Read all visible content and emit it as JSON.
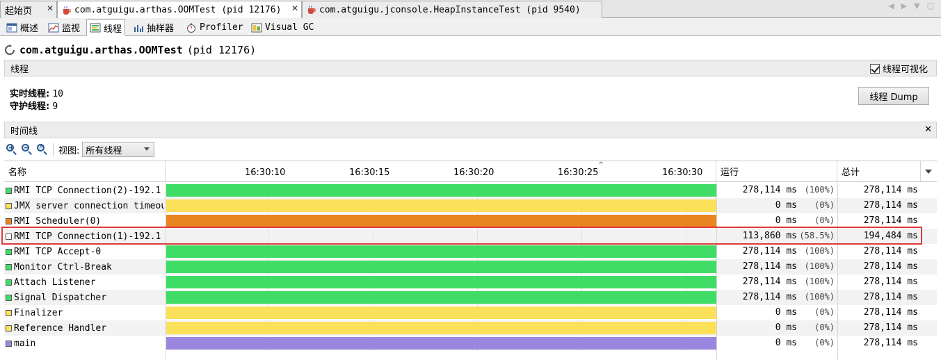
{
  "doc_tabs": [
    {
      "label": "起始页"
    },
    {
      "label": "com.atguigu.arthas.OOMTest (pid 12176)"
    },
    {
      "label": "com.atguigu.jconsole.HeapInstanceTest (pid 9540)"
    }
  ],
  "sub_tabs": [
    {
      "label": "概述"
    },
    {
      "label": "监视"
    },
    {
      "label": "线程"
    },
    {
      "label": "抽样器"
    },
    {
      "label": "Profiler"
    },
    {
      "label": "Visual GC"
    }
  ],
  "header": {
    "app_name": "com.atguigu.arthas.OOMTest",
    "pid": "(pid 12176)"
  },
  "threads_section": {
    "title": "线程",
    "visualize_label": "线程可视化",
    "visualize_checked": true,
    "live_label": "实时线程:",
    "live_value": "10",
    "daemon_label": "守护线程:",
    "daemon_value": "9",
    "dump_button": "线程 Dump"
  },
  "timeline_section": {
    "title": "时间线",
    "view_label": "视图:",
    "view_selected": "所有线程"
  },
  "table": {
    "columns": {
      "name": "名称",
      "running": "运行",
      "total": "总计"
    },
    "ticks": [
      "16:30:10",
      "16:30:15",
      "16:30:20",
      "16:30:25",
      "16:30:30"
    ],
    "rows": [
      {
        "name": "RMI TCP Connection(2)-192.1",
        "state_color": "#3fdd66",
        "running": "278,114 ms",
        "pct": "(100%)",
        "total": "278,114 ms"
      },
      {
        "name": "JMX server connection timeout",
        "state_color": "#fbe05a",
        "running": "0 ms",
        "pct": "(0%)",
        "total": "278,114 ms"
      },
      {
        "name": "RMI Scheduler(0)",
        "state_color": "#ea8421",
        "running": "0 ms",
        "pct": "(0%)",
        "total": "278,114 ms"
      },
      {
        "name": "RMI TCP Connection(1)-192.1",
        "state_color": "#ffffff",
        "running": "113,860 ms",
        "pct": "(58.5%)",
        "total": "194,484 ms"
      },
      {
        "name": "RMI TCP Accept-0",
        "state_color": "#3fdd66",
        "running": "278,114 ms",
        "pct": "(100%)",
        "total": "278,114 ms"
      },
      {
        "name": "Monitor Ctrl-Break",
        "state_color": "#3fdd66",
        "running": "278,114 ms",
        "pct": "(100%)",
        "total": "278,114 ms"
      },
      {
        "name": "Attach Listener",
        "state_color": "#3fdd66",
        "running": "278,114 ms",
        "pct": "(100%)",
        "total": "278,114 ms"
      },
      {
        "name": "Signal Dispatcher",
        "state_color": "#3fdd66",
        "running": "278,114 ms",
        "pct": "(100%)",
        "total": "278,114 ms"
      },
      {
        "name": "Finalizer",
        "state_color": "#fbe05a",
        "running": "0 ms",
        "pct": "(0%)",
        "total": "278,114 ms"
      },
      {
        "name": "Reference Handler",
        "state_color": "#fbe05a",
        "running": "0 ms",
        "pct": "(0%)",
        "total": "278,114 ms"
      },
      {
        "name": "main",
        "state_color": "#9b86df",
        "running": "0 ms",
        "pct": "(0%)",
        "total": "278,114 ms"
      }
    ]
  }
}
